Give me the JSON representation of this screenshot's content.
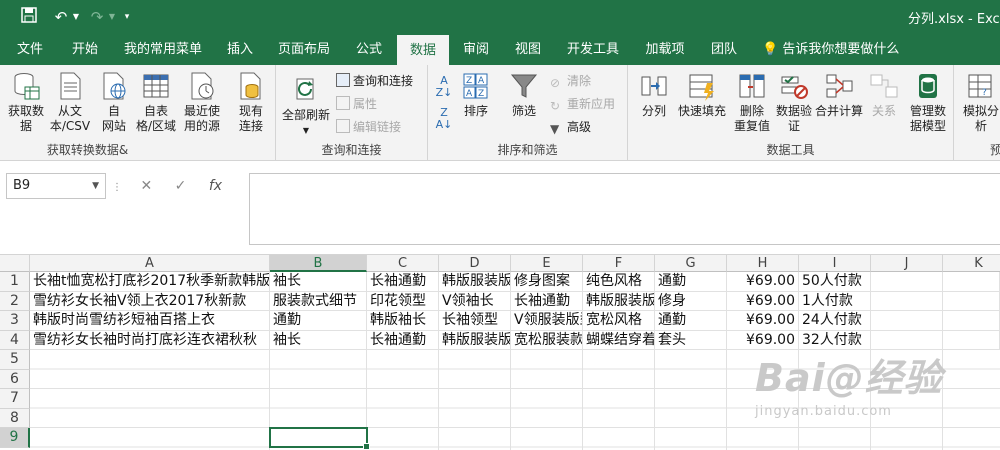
{
  "titlebar": {
    "title": "分列.xlsx  -  Excel",
    "qat": [
      "save-icon",
      "undo-icon",
      "redo-icon",
      "customize-icon"
    ]
  },
  "tabs": [
    "文件",
    "开始",
    "我的常用菜单",
    "插入",
    "页面布局",
    "公式",
    "数据",
    "审阅",
    "视图",
    "开发工具",
    "加载项",
    "团队"
  ],
  "active_tab": "数据",
  "tellme": "告诉我你想要做什么",
  "ribbon": {
    "get_data": {
      "label": "获取转换数据&",
      "buttons": [
        "获取数\n据",
        "从文\n本/CSV",
        "自\n网站",
        "自表\n格/区域",
        "最近使\n用的源",
        "现有\n连接"
      ]
    },
    "queries": {
      "label": "查询和连接",
      "refresh": "全部刷新",
      "items": [
        "查询和连接",
        "属性",
        "编辑链接"
      ]
    },
    "sort_filter": {
      "label": "排序和筛选",
      "sort": "排序",
      "filter": "筛选",
      "items": [
        "清除",
        "重新应用",
        "高级"
      ]
    },
    "data_tools": {
      "label": "数据工具",
      "buttons": [
        "分列",
        "快速填充",
        "删除\n重复值",
        "数据验\n证",
        "合并计算",
        "关系",
        "管理数\n据模型"
      ]
    },
    "forecast": {
      "label": "预",
      "buttons": [
        "模拟分\n析"
      ]
    }
  },
  "formula_bar": {
    "name_box": "B9",
    "fx_label": "fx",
    "formula": ""
  },
  "columns": [
    "A",
    "B",
    "C",
    "D",
    "E",
    "F",
    "G",
    "H",
    "I",
    "J",
    "K"
  ],
  "rows": [
    "1",
    "2",
    "3",
    "4",
    "5",
    "6",
    "7",
    "8",
    "9"
  ],
  "cells": [
    [
      "长袖t恤宽松打底衫2017秋季新款韩版",
      "袖长",
      "长袖通勤",
      "韩版服装版型",
      "修身图案",
      "纯色风格",
      "通勤",
      "¥69.00",
      "50人付款"
    ],
    [
      "雪纺衫女长袖V领上衣2017秋新款",
      "服装款式细节",
      "印花领型",
      "V领袖长",
      "长袖通勤",
      "韩版服装版型",
      "修身",
      "¥69.00",
      "1人付款"
    ],
    [
      "韩版时尚雪纺衫短袖百搭上衣",
      "通勤",
      "韩版袖长",
      "长袖领型",
      "V领服装版型",
      "宽松风格",
      "通勤",
      "¥69.00",
      "24人付款"
    ],
    [
      "雪纺衫女长袖时尚打底衫连衣裙秋秋",
      "袖长",
      "长袖通勤",
      "韩版服装版型",
      "宽松服装款式",
      "蝴蝶结穿着方式",
      "套头",
      "¥69.00",
      "32人付款"
    ]
  ],
  "watermark": {
    "main": "Bai@经验",
    "sub": "jingyan.baidu.com"
  },
  "colors": {
    "excel_green": "#217346",
    "ribbon_bg": "#f3f3f3"
  }
}
